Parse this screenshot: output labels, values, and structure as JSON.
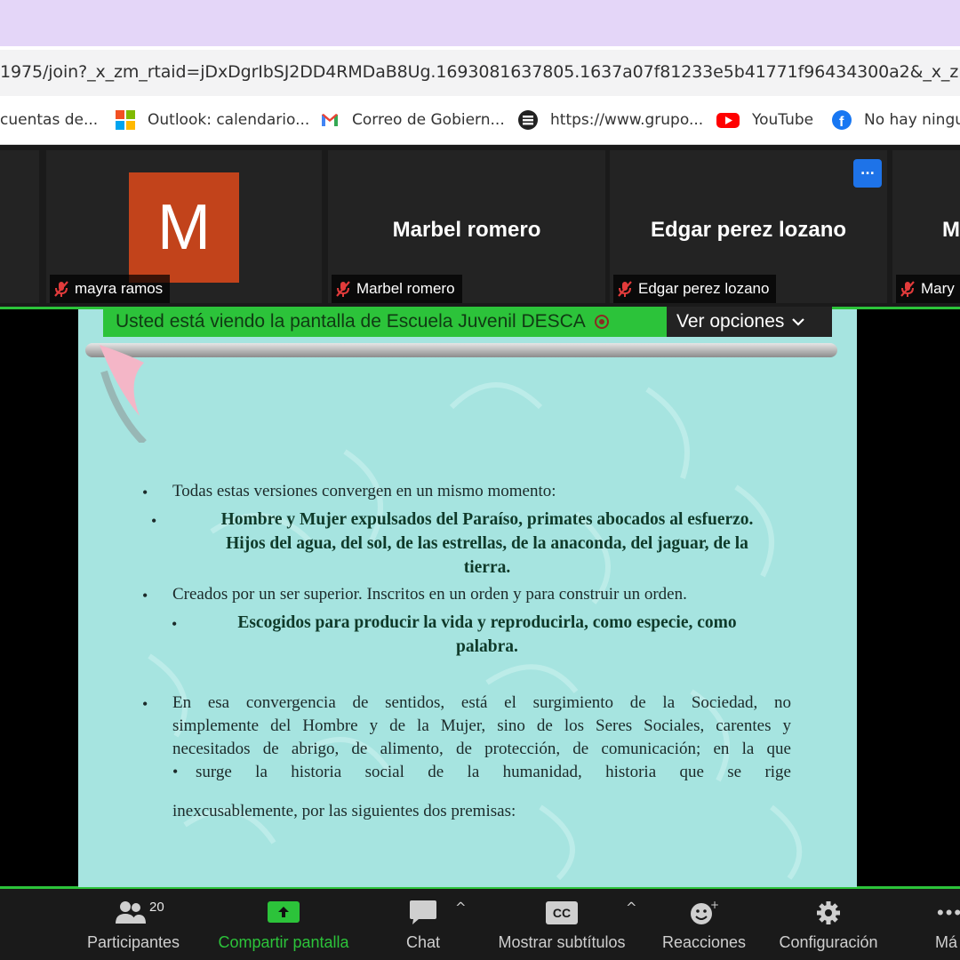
{
  "browser": {
    "url": "1975/join?_x_zm_rtaid=jDxDgrIbSJ2DD4RMDaB8Ug.1693081637805.1637a07f81233e5b41771f96434300a2&_x_zm_rh",
    "bookmarks": [
      {
        "label": "cuentas de..."
      },
      {
        "label": "Outlook: calendario..."
      },
      {
        "label": "Correo de Gobiern..."
      },
      {
        "label": "https://www.grupo..."
      },
      {
        "label": "YouTube"
      },
      {
        "label": "No hay ningu"
      }
    ]
  },
  "participants": [
    {
      "label": "mayra ramos",
      "avatar_letter": "M"
    },
    {
      "big_name": "Marbel romero",
      "label": "Marbel romero"
    },
    {
      "big_name": "Edgar perez lozano",
      "label": "Edgar perez lozano",
      "more_label": "..."
    },
    {
      "big_name": "M",
      "label": "Mary"
    }
  ],
  "share": {
    "banner": "Usted está viendo la pantalla de Escuela Juvenil DESCA",
    "view_options": "Ver opciones"
  },
  "slide": {
    "line1": "Todas estas versiones convergen en un mismo momento:",
    "bold1a": "Hombre y Mujer expulsados del Paraíso, primates abocados al esfuerzo.",
    "bold1b": "Hijos del agua, del sol, de las estrellas, de la anaconda, del jaguar, de la",
    "bold1c": "tierra.",
    "line2": "Creados por un ser superior. Inscritos en un orden y para construir un orden.",
    "bold2a": "Escogidos para producir la vida y reproducirla, como especie, como",
    "bold2b": "palabra.",
    "para1": "En esa convergencia de sentidos, está el surgimiento de la Sociedad, no",
    "para2": "simplemente del Hombre y de la Mujer, sino de los Seres Sociales, carentes y",
    "para3": "necesitados de abrigo, de alimento, de protección, de comunicación; en la que",
    "para4": "surge la historia social de la humanidad, historia que se rige",
    "para5": "inexcusablemente, por las siguientes dos premisas:"
  },
  "toolbar": {
    "participants_label": "Participantes",
    "participants_count": "20",
    "share_label": "Compartir pantalla",
    "chat_label": "Chat",
    "subtitles_label": "Mostrar subtítulos",
    "subtitles_icon_text": "CC",
    "reactions_label": "Reacciones",
    "settings_label": "Configuración",
    "more_label": "Má"
  },
  "colors": {
    "share_green": "#2cc33a",
    "slide_bg": "#a6e4e0",
    "avatar_bg": "#c2431b",
    "more_btn": "#1e73e8"
  }
}
